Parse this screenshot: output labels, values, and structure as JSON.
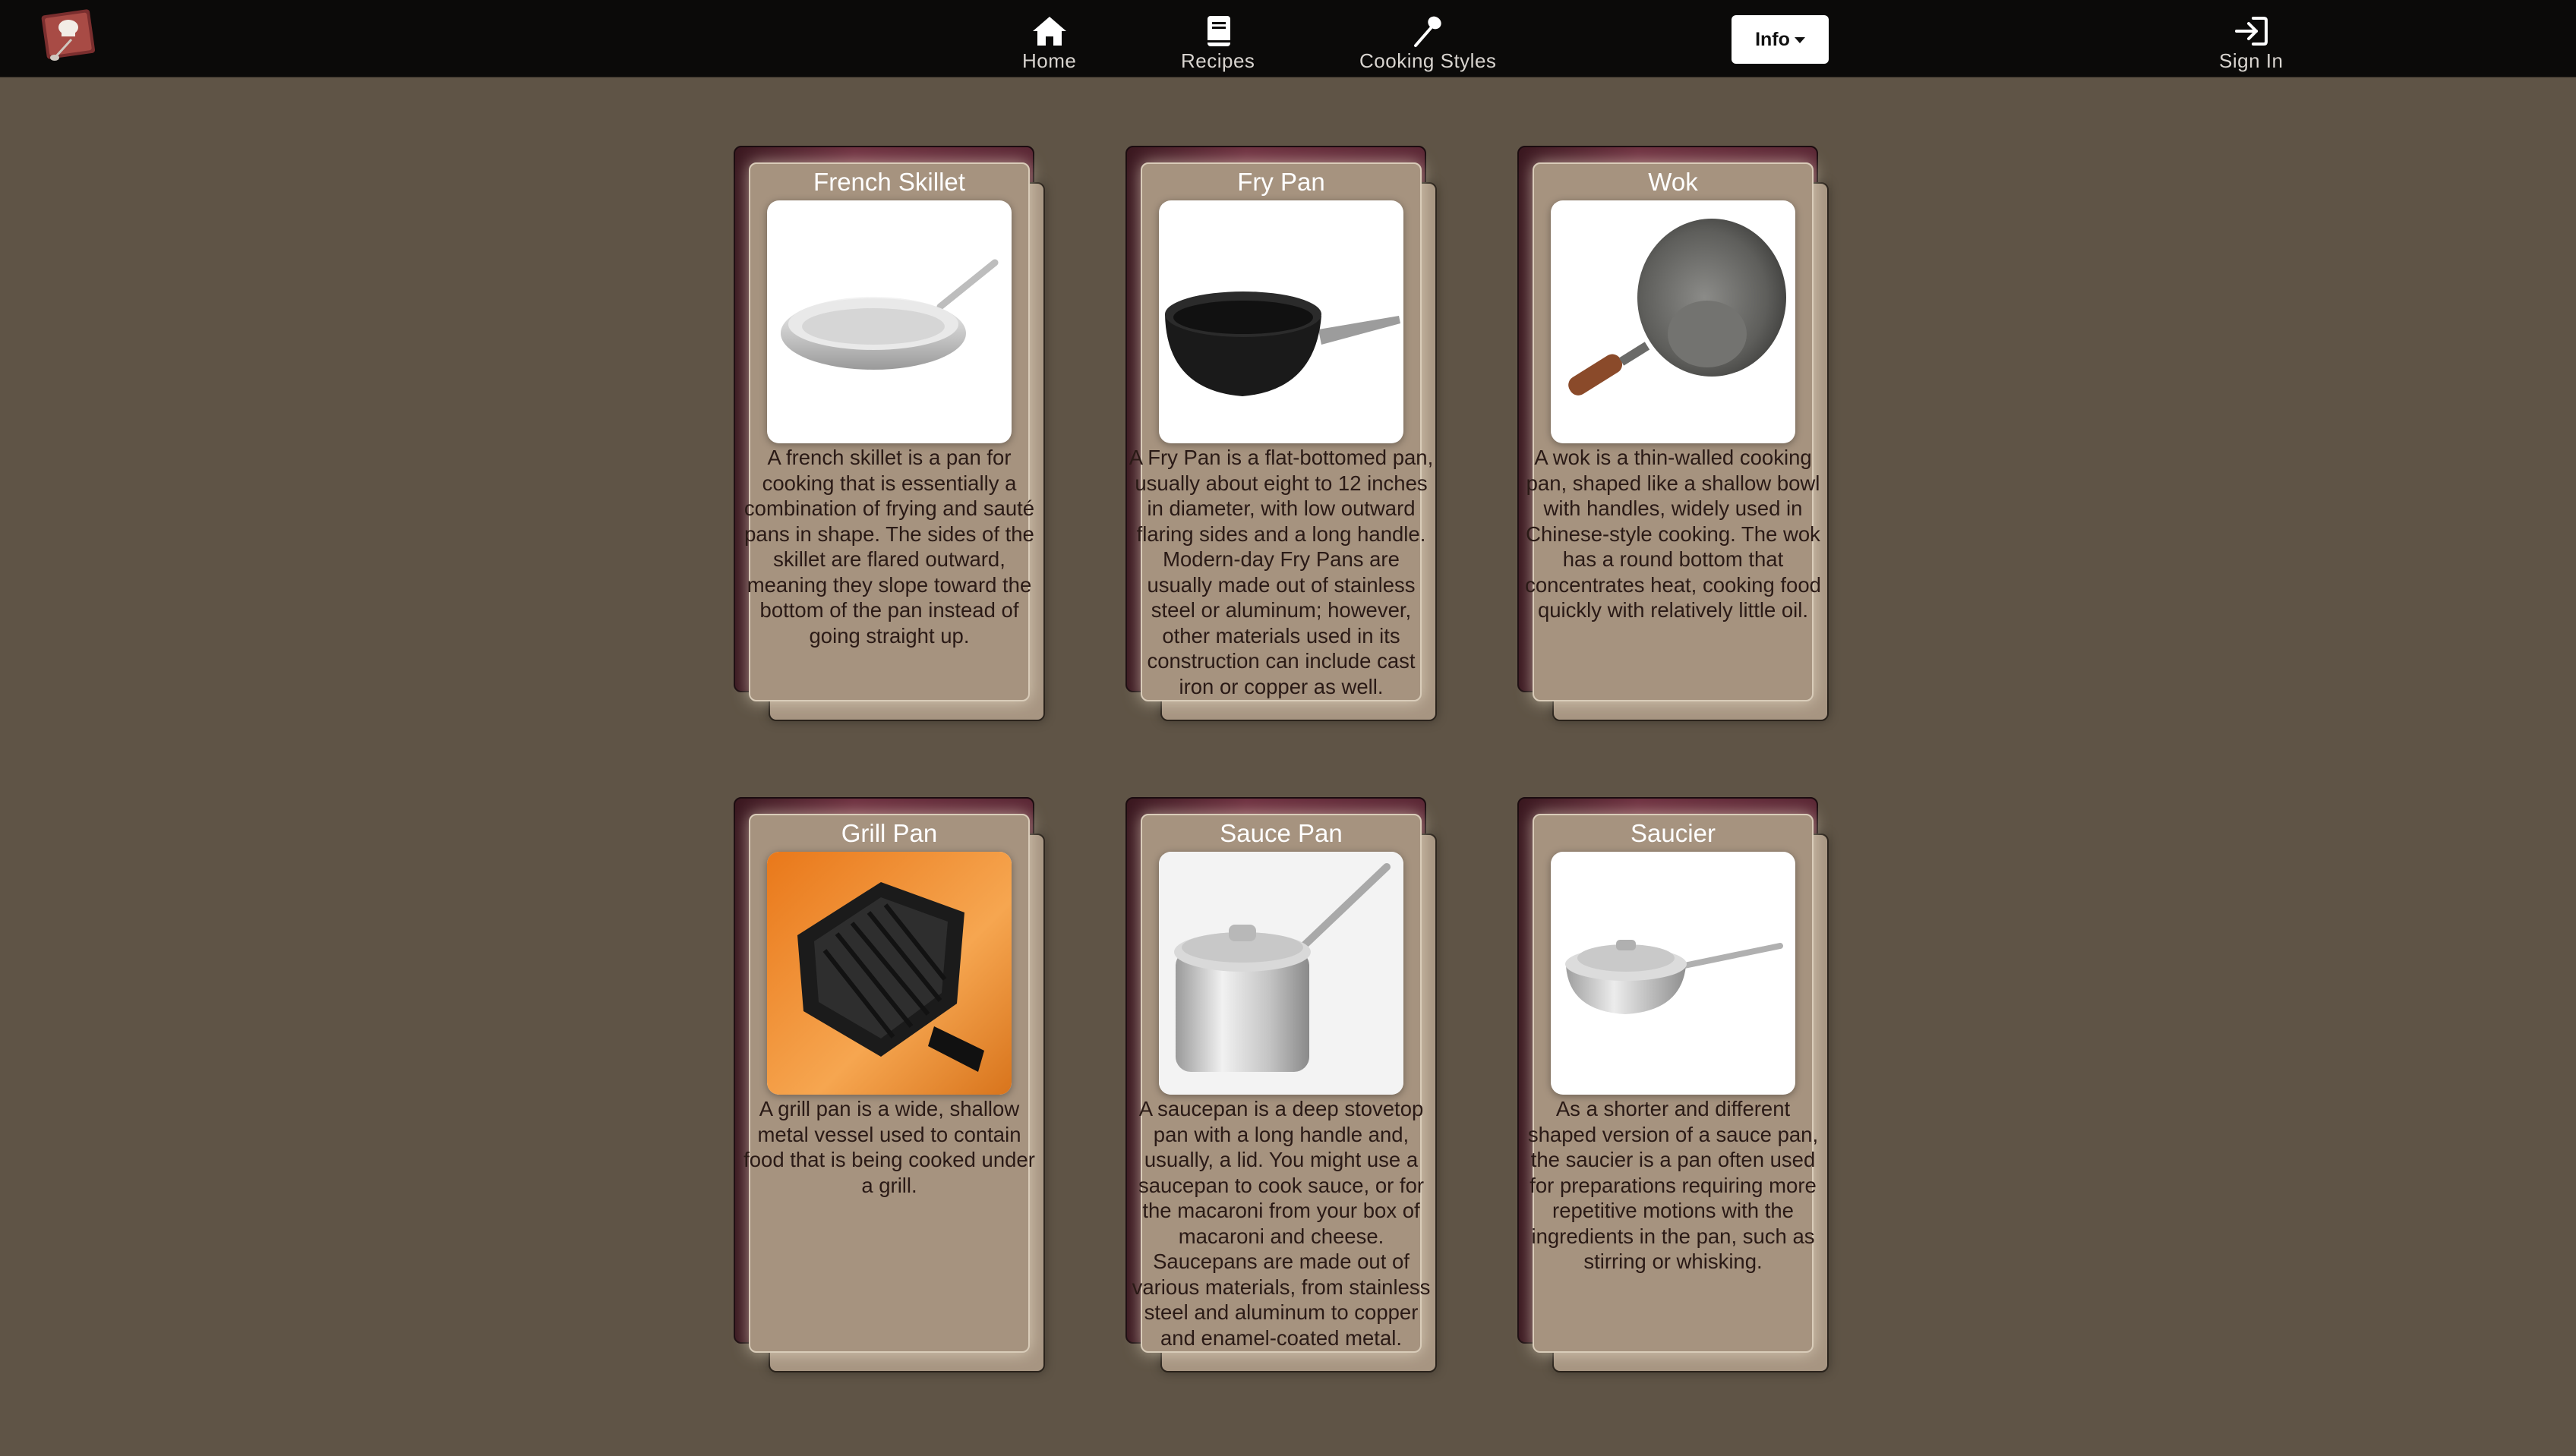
{
  "nav": {
    "logo_icon": "chef-hat-book-logo",
    "items": [
      {
        "label": "Home",
        "icon": "home-icon"
      },
      {
        "label": "Recipes",
        "icon": "book-icon"
      },
      {
        "label": "Cooking Styles",
        "icon": "spoon-icon"
      }
    ],
    "info_label": "Info",
    "sign_in_label": "Sign In",
    "sign_in_icon": "sign-in-icon"
  },
  "colors": {
    "page_background": "#5f5446",
    "navbar": "#0b0a09",
    "card_body": "#a6937f",
    "card_accent": "#6e3040",
    "card_text": "#2a1a16"
  },
  "cards": [
    {
      "title": "French Skillet",
      "image": "french-skillet-photo",
      "description": "A french skillet is a pan for cooking that is essentially a combination of frying and sauté pans in shape. The sides of the skillet are flared outward, meaning they slope toward the bottom of the pan instead of going straight up."
    },
    {
      "title": "Fry Pan",
      "image": "fry-pan-photo",
      "description": "A Fry Pan is a flat-bottomed pan, usually about eight to 12 inches in diameter, with low outward flaring sides and a long handle. Modern-day Fry Pans are usually made out of stainless steel or aluminum; however, other materials used in its construction can include cast iron or copper as well."
    },
    {
      "title": "Wok",
      "image": "wok-photo",
      "description": "A wok is a thin-walled cooking pan, shaped like a shallow bowl with handles, widely used in Chinese-style cooking. The wok has a round bottom that concentrates heat, cooking food quickly with relatively little oil."
    },
    {
      "title": "Grill Pan",
      "image": "grill-pan-photo",
      "description": "A grill pan is a wide, shallow metal vessel used to contain food that is being cooked under a grill."
    },
    {
      "title": "Sauce Pan",
      "image": "sauce-pan-photo",
      "description": "A saucepan is a deep stovetop pan with a long handle and, usually, a lid. You might use a saucepan to cook sauce, or for the macaroni from your box of macaroni and cheese. Saucepans are made out of various materials, from stainless steel and aluminum to copper and enamel-coated metal."
    },
    {
      "title": "Saucier",
      "image": "saucier-photo",
      "description": "As a shorter and different shaped version of a sauce pan, the saucier is a pan often used for preparations requiring more repetitive motions with the ingredients in the pan, such as stirring or whisking."
    }
  ]
}
